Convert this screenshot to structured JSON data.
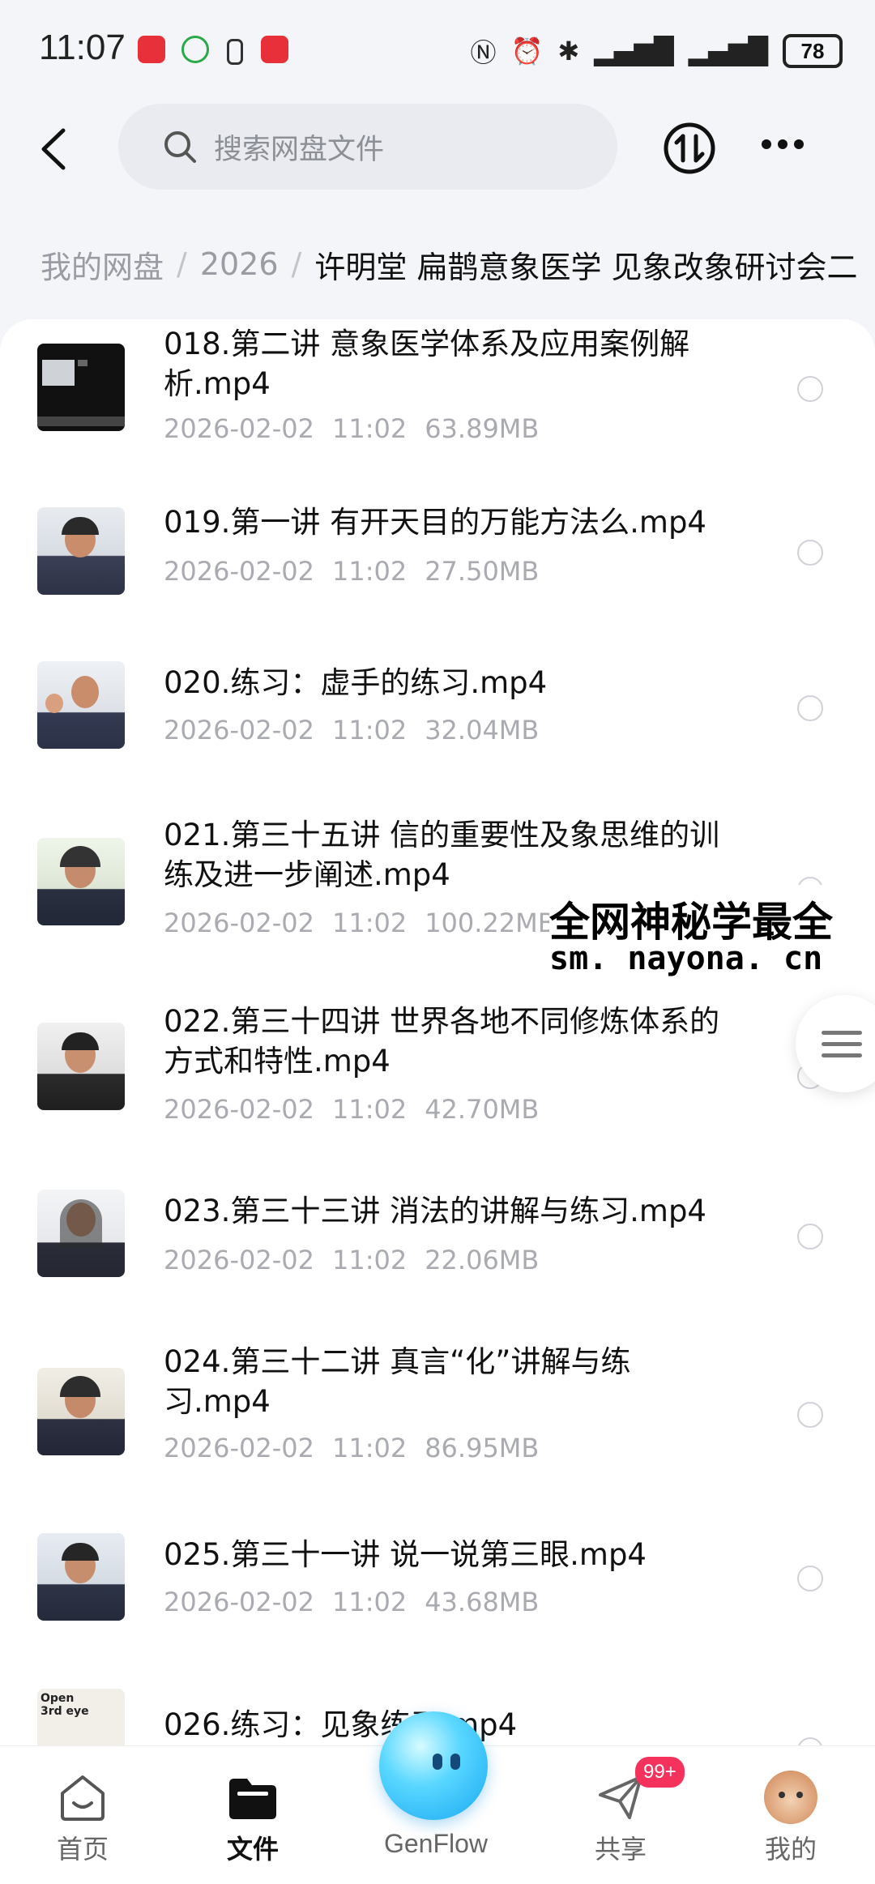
{
  "status_bar": {
    "time": "11:07",
    "battery": "78"
  },
  "search": {
    "placeholder": "搜索网盘文件"
  },
  "breadcrumb": {
    "root": "我的网盘",
    "year": "2026",
    "current": "许明堂 扁鹊意象医学 见象改象研讨会二"
  },
  "files": [
    {
      "name": "018.第二讲 意象医学体系及应用案例解析.mp4",
      "date": "2026-02-02",
      "time": "11:02",
      "size": "63.89MB"
    },
    {
      "name": "019.第一讲 有开天目的万能方法么.mp4",
      "date": "2026-02-02",
      "time": "11:02",
      "size": "27.50MB"
    },
    {
      "name": "020.练习：虚手的练习.mp4",
      "date": "2026-02-02",
      "time": "11:02",
      "size": "32.04MB"
    },
    {
      "name": "021.第三十五讲 信的重要性及象思维的训练及进一步阐述.mp4",
      "date": "2026-02-02",
      "time": "11:02",
      "size": "100.22MB"
    },
    {
      "name": "022.第三十四讲 世界各地不同修炼体系的方式和特性.mp4",
      "date": "2026-02-02",
      "time": "11:02",
      "size": "42.70MB"
    },
    {
      "name": "023.第三十三讲 消法的讲解与练习.mp4",
      "date": "2026-02-02",
      "time": "11:02",
      "size": "22.06MB"
    },
    {
      "name": "024.第三十二讲 真言“化”讲解与练习.mp4",
      "date": "2026-02-02",
      "time": "11:02",
      "size": "86.95MB"
    },
    {
      "name": "025.第三十一讲 说一说第三眼.mp4",
      "date": "2026-02-02",
      "time": "11:02",
      "size": "43.68MB"
    },
    {
      "name": "026.练习：见象练习.mp4"
    }
  ],
  "thumb_026_text": "Open 3rd eye",
  "watermark": {
    "line1": "全网神秘学最全",
    "line2": "sm. nayona. cn"
  },
  "tabs": {
    "home": "首页",
    "files": "文件",
    "genflow": "GenFlow",
    "share": "共享",
    "mine": "我的",
    "share_badge": "99+"
  },
  "colors": {
    "accent": "#111111",
    "badge": "#f5325c",
    "meta_text": "#a9abb1"
  }
}
